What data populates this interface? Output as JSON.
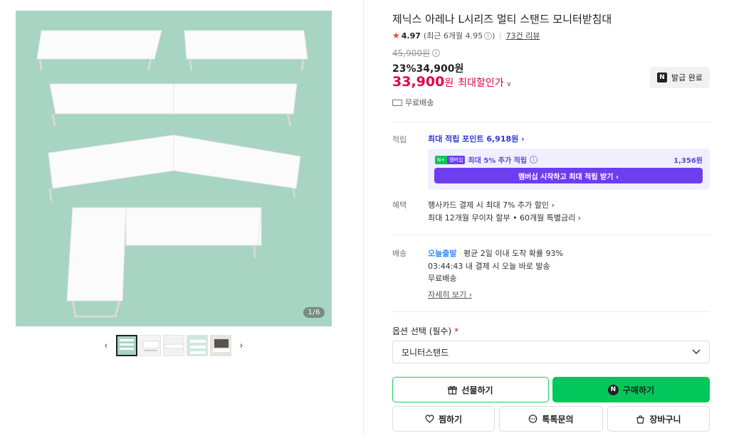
{
  "gallery": {
    "counter": "1/6",
    "prev_label": "‹",
    "next_label": "›"
  },
  "product": {
    "title": "제닉스 아레나 L시리즈 멀티 스탠드 모니터받침대",
    "rating": "4.97",
    "recent_rating": "(최근 6개월 4.95",
    "recent_rating_end": ")",
    "review_count": "73건 리뷰",
    "original_price": "45,900원",
    "discount_price": "23%34,900원",
    "max_price_number": "33,900",
    "max_price_won": "원",
    "max_price_label": "최대할인가",
    "coupon_label": "발급 완료",
    "shipping": "무료배송"
  },
  "points": {
    "label": "적립",
    "max_points": "최대 적립 포인트 6,918원 ›",
    "membership_badge_left": "N+",
    "membership_badge_right": "멤버십",
    "membership_text": "최대 5% 추가 적립",
    "membership_value": "1,356원",
    "membership_button": "멤버십 시작하고 최대 적립 받기 ›"
  },
  "benefits": {
    "label": "혜택",
    "line1": "행사카드 결제 시 최대 7% 추가 할인 ›",
    "line2": "최대 12개월 무이자 할부 • 60개월 특별금리 ›"
  },
  "delivery": {
    "label": "배송",
    "today": "오늘출발",
    "line1_rest": "평균 2일 이내 도착 확률 93%",
    "line2": "03:44:43  내 결제 시 오늘 바로 발송",
    "line3": "무료배송",
    "more": "자세히 보기 ›"
  },
  "options": {
    "label": "옵션 선택 (필수)",
    "required_mark": "*",
    "selected": "모니터스탠드"
  },
  "actions": {
    "gift": "선물하기",
    "buy": "구매하기",
    "wish": "찜하기",
    "talk": "톡톡문의",
    "cart": "장바구니"
  }
}
